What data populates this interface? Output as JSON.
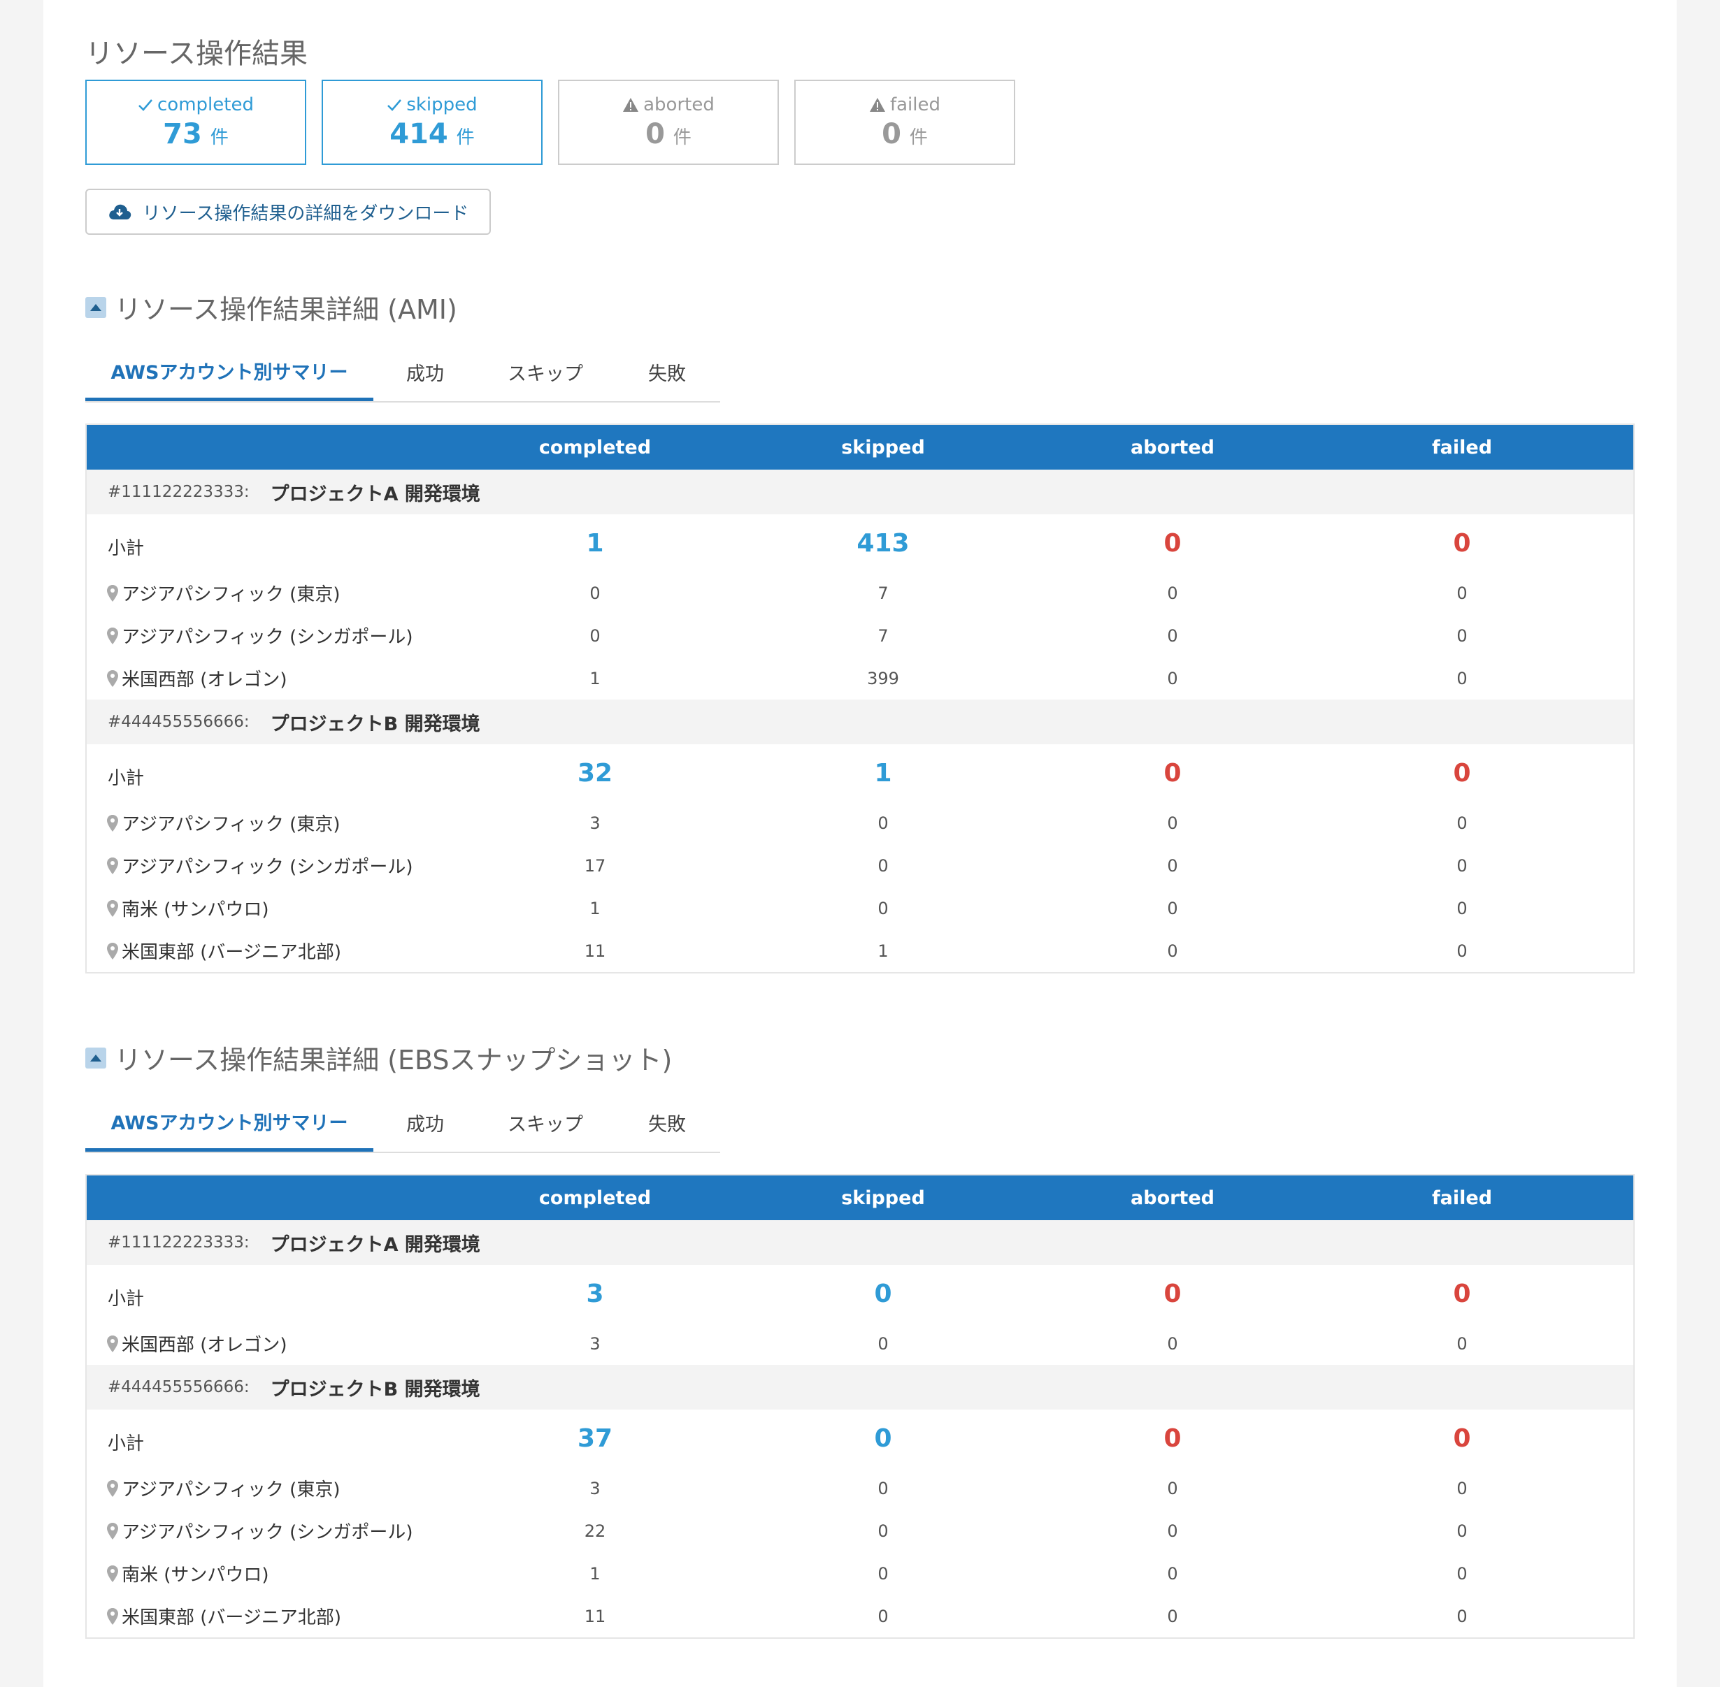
{
  "page": {
    "title": "リソース操作結果"
  },
  "cards": [
    {
      "label": "completed",
      "count": "73",
      "unit": "件",
      "icon": "check-icon",
      "state": "active"
    },
    {
      "label": "skipped",
      "count": "414",
      "unit": "件",
      "icon": "check-icon",
      "state": "active"
    },
    {
      "label": "aborted",
      "count": "0",
      "unit": "件",
      "icon": "warning-icon",
      "state": "muted"
    },
    {
      "label": "failed",
      "count": "0",
      "unit": "件",
      "icon": "warning-icon",
      "state": "muted"
    }
  ],
  "download": {
    "label": "リソース操作結果の詳細をダウンロード",
    "icon": "cloud-download-icon"
  },
  "colors": {
    "accent": "#1f77bf",
    "highlight": "#2f9bd6",
    "danger": "#d9453d"
  },
  "sections": [
    {
      "title": "リソース操作結果詳細 (AMI)",
      "tabs": [
        "AWSアカウント別サマリー",
        "成功",
        "スキップ",
        "失敗"
      ],
      "active_tab": 0,
      "columns": [
        "",
        "completed",
        "skipped",
        "aborted",
        "failed"
      ],
      "accounts": [
        {
          "id": "#111122223333:",
          "name": "プロジェクトA 開発環境",
          "subtotal_label": "小計",
          "subtotal": [
            "1",
            "413",
            "0",
            "0"
          ],
          "regions": [
            {
              "name": "アジアパシフィック (東京)",
              "values": [
                "0",
                "7",
                "0",
                "0"
              ]
            },
            {
              "name": "アジアパシフィック (シンガポール)",
              "values": [
                "0",
                "7",
                "0",
                "0"
              ]
            },
            {
              "name": "米国西部 (オレゴン)",
              "values": [
                "1",
                "399",
                "0",
                "0"
              ]
            }
          ]
        },
        {
          "id": "#444455556666:",
          "name": "プロジェクトB 開発環境",
          "subtotal_label": "小計",
          "subtotal": [
            "32",
            "1",
            "0",
            "0"
          ],
          "regions": [
            {
              "name": "アジアパシフィック (東京)",
              "values": [
                "3",
                "0",
                "0",
                "0"
              ]
            },
            {
              "name": "アジアパシフィック (シンガポール)",
              "values": [
                "17",
                "0",
                "0",
                "0"
              ]
            },
            {
              "name": "南米 (サンパウロ)",
              "values": [
                "1",
                "0",
                "0",
                "0"
              ]
            },
            {
              "name": "米国東部 (バージニア北部)",
              "values": [
                "11",
                "1",
                "0",
                "0"
              ]
            }
          ]
        }
      ]
    },
    {
      "title": "リソース操作結果詳細 (EBSスナップショット)",
      "tabs": [
        "AWSアカウント別サマリー",
        "成功",
        "スキップ",
        "失敗"
      ],
      "active_tab": 0,
      "columns": [
        "",
        "completed",
        "skipped",
        "aborted",
        "failed"
      ],
      "accounts": [
        {
          "id": "#111122223333:",
          "name": "プロジェクトA 開発環境",
          "subtotal_label": "小計",
          "subtotal": [
            "3",
            "0",
            "0",
            "0"
          ],
          "regions": [
            {
              "name": "米国西部 (オレゴン)",
              "values": [
                "3",
                "0",
                "0",
                "0"
              ]
            }
          ]
        },
        {
          "id": "#444455556666:",
          "name": "プロジェクトB 開発環境",
          "subtotal_label": "小計",
          "subtotal": [
            "37",
            "0",
            "0",
            "0"
          ],
          "regions": [
            {
              "name": "アジアパシフィック (東京)",
              "values": [
                "3",
                "0",
                "0",
                "0"
              ]
            },
            {
              "name": "アジアパシフィック (シンガポール)",
              "values": [
                "22",
                "0",
                "0",
                "0"
              ]
            },
            {
              "name": "南米 (サンパウロ)",
              "values": [
                "1",
                "0",
                "0",
                "0"
              ]
            },
            {
              "name": "米国東部 (バージニア北部)",
              "values": [
                "11",
                "0",
                "0",
                "0"
              ]
            }
          ]
        }
      ]
    }
  ]
}
